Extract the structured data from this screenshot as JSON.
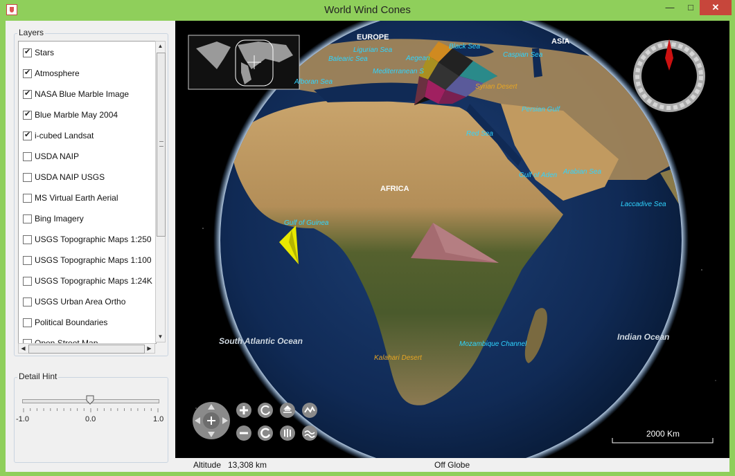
{
  "window": {
    "title": "World Wind Cones"
  },
  "layers_panel": {
    "title": "Layers",
    "items": [
      {
        "label": "Stars",
        "checked": true
      },
      {
        "label": "Atmosphere",
        "checked": true
      },
      {
        "label": "NASA Blue Marble Image",
        "checked": true
      },
      {
        "label": "Blue Marble May 2004",
        "checked": true
      },
      {
        "label": "i-cubed Landsat",
        "checked": true
      },
      {
        "label": "USDA NAIP",
        "checked": false
      },
      {
        "label": "USDA NAIP USGS",
        "checked": false
      },
      {
        "label": "MS Virtual Earth Aerial",
        "checked": false
      },
      {
        "label": "Bing Imagery",
        "checked": false
      },
      {
        "label": "USGS Topographic Maps 1:250",
        "checked": false
      },
      {
        "label": "USGS Topographic Maps 1:100",
        "checked": false
      },
      {
        "label": "USGS Topographic Maps 1:24K",
        "checked": false
      },
      {
        "label": "USGS Urban Area Ortho",
        "checked": false
      },
      {
        "label": "Political Boundaries",
        "checked": false
      },
      {
        "label": "Open Street Map",
        "checked": false
      }
    ]
  },
  "detail_hint": {
    "title": "Detail Hint",
    "min_label": "-1.0",
    "mid_label": "0.0",
    "max_label": "1.0",
    "value": 0.0
  },
  "map_labels": {
    "continents": {
      "europe": "EUROPE",
      "asia": "ASIA",
      "africa": "AFRICA"
    },
    "oceans": {
      "south_atlantic": "South Atlantic Ocean",
      "indian": "Indian Ocean"
    },
    "seas": {
      "ligurian": "Ligurian Sea",
      "balearic": "Balearic Sea",
      "aegean": "Aegean",
      "black": "Black Sea",
      "caspian": "Caspian Sea",
      "mediterranean": "Mediterranean S",
      "alboran": "Alboran Sea",
      "persian": "Persian Gulf",
      "red": "Red Sea",
      "aden": "Gulf of Aden",
      "arabian": "Arabian Sea",
      "laccadive": "Laccadive Sea",
      "guinea": "Gulf of Guinea",
      "mozambique": "Mozambique Channel"
    },
    "deserts": {
      "syrian": "Syrian Desert",
      "kalahari": "Kalahari Desert"
    }
  },
  "scale_bar": {
    "label": "2000 Km"
  },
  "status_bar": {
    "altitude_label": "Altitude",
    "altitude_value": "13,308 km",
    "globe_status": "Off Globe"
  },
  "controls": [
    "pan-control",
    "zoom-in",
    "zoom-out",
    "heading-left",
    "heading-reset",
    "pitch-up",
    "pitch-down",
    "vertical-exaggeration-up",
    "vertical-exaggeration-down"
  ],
  "colors": {
    "accent_frame": "#8fcf5b",
    "close_button": "#c7463b",
    "cone_yellow": "#e8e800",
    "cone_pink": "#a56b70",
    "compass_needle": "#cc1111"
  }
}
